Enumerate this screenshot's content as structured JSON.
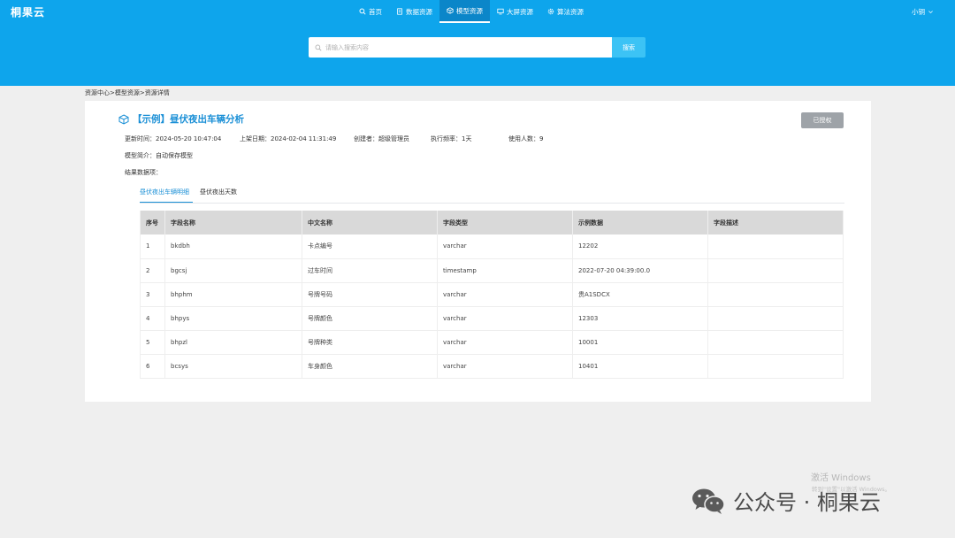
{
  "header": {
    "logo": "桐果云",
    "nav": [
      {
        "label": "首页",
        "icon": "search-icon"
      },
      {
        "label": "数据资源",
        "icon": "document-icon"
      },
      {
        "label": "模型资源",
        "icon": "cube-icon",
        "active": true
      },
      {
        "label": "大屏资源",
        "icon": "monitor-icon"
      },
      {
        "label": "算法资源",
        "icon": "gear-icon"
      }
    ],
    "user": "小铜",
    "search_placeholder": "请输入搜索内容",
    "search_button": "搜索"
  },
  "breadcrumb": "资源中心>模型资源>资源详情",
  "detail": {
    "title": "【示例】昼伏夜出车辆分析",
    "auth_button": "已授权",
    "update_time": "更新时间：2024-05-20 10:47:04",
    "publish_date": "上架日期：2024-02-04 11:31:49",
    "creator": "创建者：超级管理员",
    "frequency": "执行频率：1天",
    "users": "使用人数：9",
    "intro": "模型简介：自动保存模型",
    "result_items": "结果数据项："
  },
  "tabs": [
    "昼伏夜出车辆明细",
    "昼伏夜出天数"
  ],
  "table": {
    "headers": [
      "序号",
      "字段名称",
      "中文名称",
      "字段类型",
      "示例数据",
      "字段描述"
    ],
    "rows": [
      [
        "1",
        "bkdbh",
        "卡点编号",
        "varchar",
        "12202",
        ""
      ],
      [
        "2",
        "bgcsj",
        "过车时间",
        "timestamp",
        "2022-07-20 04:39:00.0",
        ""
      ],
      [
        "3",
        "bhphm",
        "号牌号码",
        "varchar",
        "贵A1SDCX",
        ""
      ],
      [
        "4",
        "bhpys",
        "号牌颜色",
        "varchar",
        "12303",
        ""
      ],
      [
        "5",
        "bhpzl",
        "号牌种类",
        "varchar",
        "10001",
        ""
      ],
      [
        "6",
        "bcsys",
        "车身颜色",
        "varchar",
        "10401",
        ""
      ]
    ]
  },
  "overlay": {
    "activation": "激活 Windows",
    "activation_sub": "转到\"设置\"以激活 Windows。",
    "wechat": "公众号 · 桐果云"
  }
}
